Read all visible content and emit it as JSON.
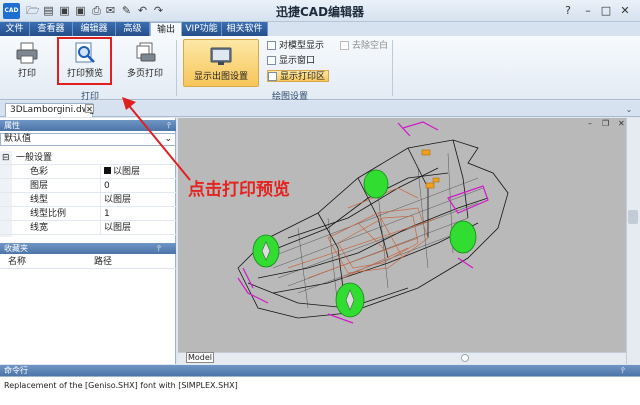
{
  "app": {
    "logo_text": "CAD",
    "title": "迅捷CAD编辑器"
  },
  "menu": {
    "tabs": [
      "文件",
      "查看器",
      "编辑器",
      "高级",
      "输出",
      "VIP功能",
      "相关软件"
    ],
    "active": "输出"
  },
  "ribbon": {
    "print_group": {
      "label": "打印",
      "buttons": [
        "打印",
        "打印预览",
        "多页打印"
      ]
    },
    "display_group": {
      "label": "绘图设置",
      "display_button": "显示出图设置",
      "options": [
        "对模型显示",
        "显示窗口",
        "显示打印区",
        "去除空白"
      ]
    }
  },
  "document": {
    "tab_name": "3DLamborgini.dwg",
    "model_tab": "Model"
  },
  "properties": {
    "title": "属性",
    "selected": "默认值",
    "section": "一般设置",
    "rows": [
      {
        "key": "色彩",
        "value": "以图层"
      },
      {
        "key": "图层",
        "value": "0"
      },
      {
        "key": "线型",
        "value": "以图层"
      },
      {
        "key": "线型比例",
        "value": "1"
      },
      {
        "key": "线宽",
        "value": "以图层"
      }
    ]
  },
  "favorites": {
    "title": "收藏夹",
    "col_name": "名称",
    "col_path": "路径"
  },
  "command": {
    "title": "命令行",
    "output": "Replacement of the [Geniso.SHX] font with [SIMPLEX.SHX]"
  },
  "annotation": {
    "text": "点击打印预览"
  },
  "colors": {
    "accent_red": "#e02020",
    "ribbon_blue": "#2f5c99",
    "highlight": "#f6c65a"
  }
}
